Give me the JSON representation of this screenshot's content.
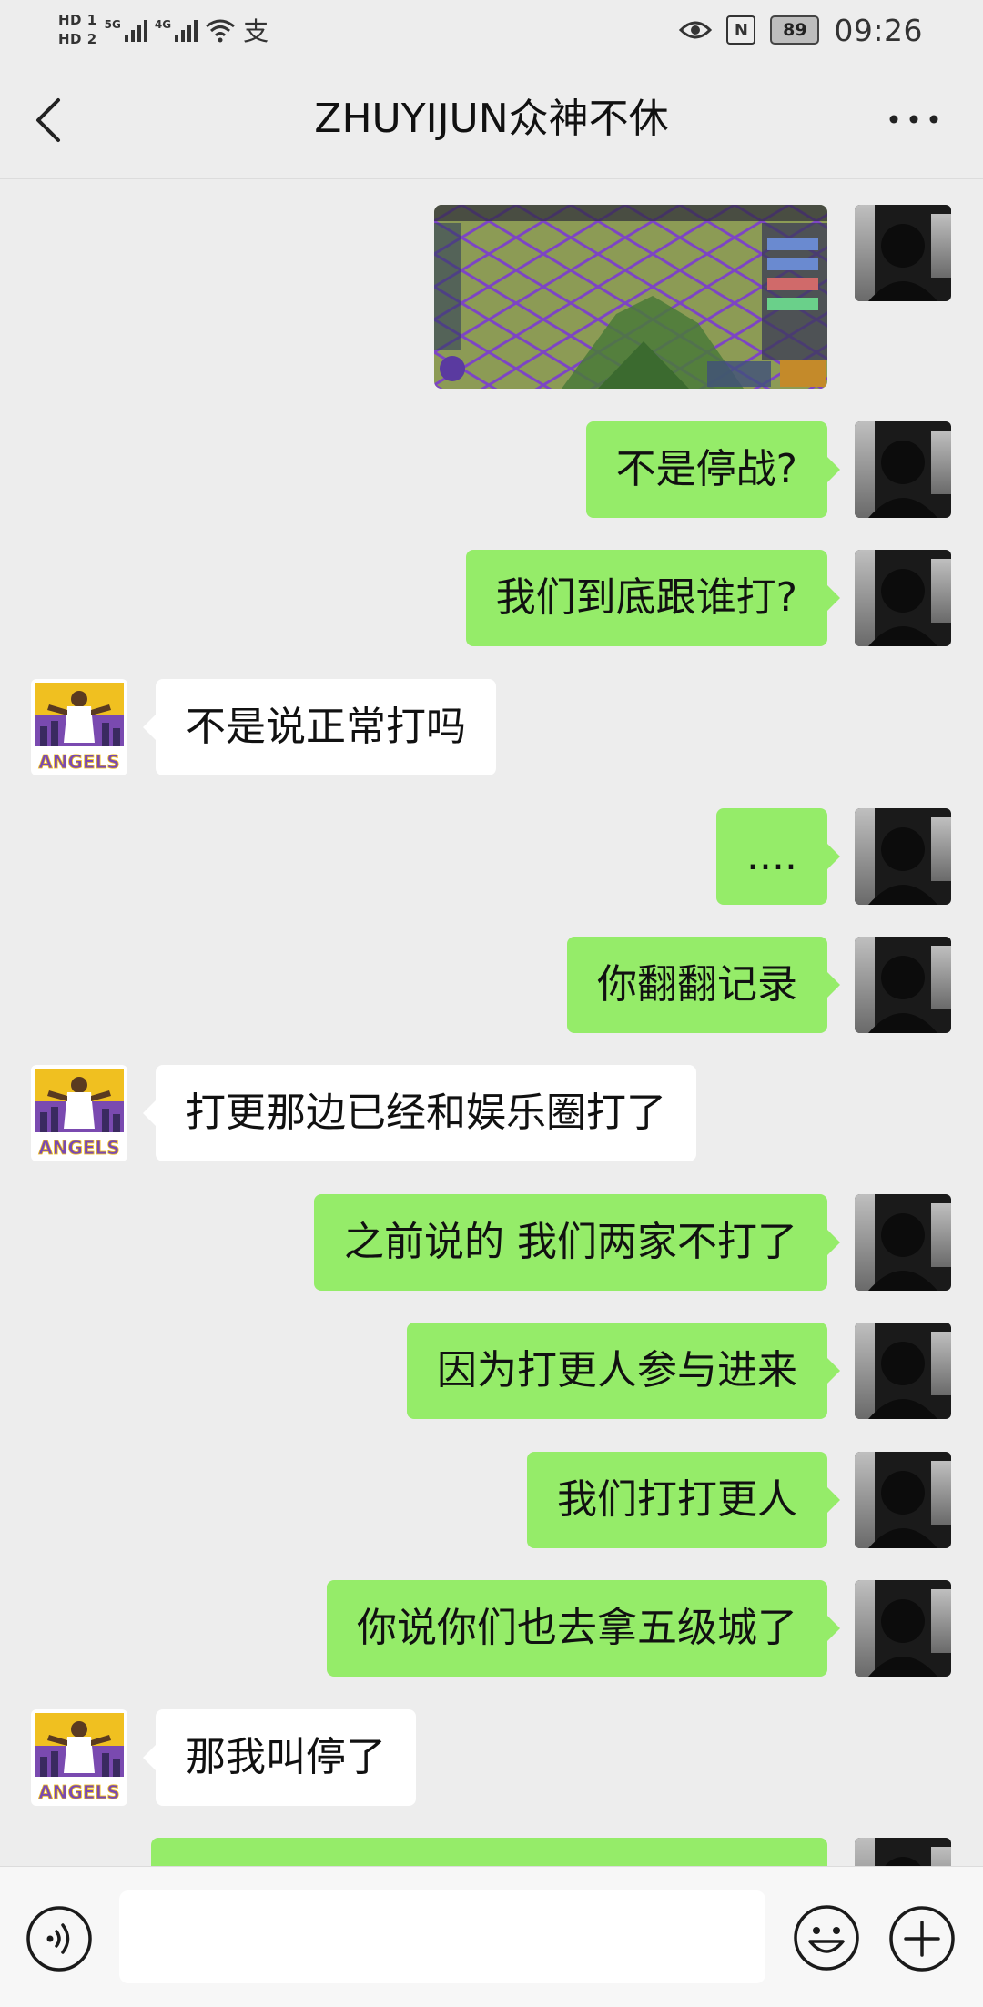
{
  "status_bar": {
    "hd1": "HD 1",
    "hd2": "HD 2",
    "sim1_type": "5G",
    "sim2_type": "4G",
    "pay_icon": "支",
    "battery": "89",
    "nfc": "N",
    "time": "09:26"
  },
  "header": {
    "title": "ZHUYIJUN众神不休"
  },
  "messages": [
    {
      "side": "out",
      "type": "image",
      "alt": ""
    },
    {
      "side": "out",
      "text": "不是停战?"
    },
    {
      "side": "out",
      "text": "我们到底跟谁打?"
    },
    {
      "side": "in",
      "text": "不是说正常打吗"
    },
    {
      "side": "out",
      "text": "...."
    },
    {
      "side": "out",
      "text": "你翻翻记录"
    },
    {
      "side": "in",
      "text": "打更那边已经和娱乐圈打了"
    },
    {
      "side": "out",
      "text": "之前说的 我们两家不打了"
    },
    {
      "side": "out",
      "text": "因为打更人参与进来"
    },
    {
      "side": "out",
      "text": "我们打打更人"
    },
    {
      "side": "out",
      "text": "你说你们也去拿五级城了"
    },
    {
      "side": "in",
      "text": "那我叫停了"
    },
    {
      "side": "out",
      "text": ""
    }
  ],
  "input_bar": {
    "text": "",
    "placeholder": ""
  },
  "colors": {
    "background": "#ededed",
    "outgoing_bubble": "#95ec69",
    "incoming_bubble": "#ffffff"
  }
}
